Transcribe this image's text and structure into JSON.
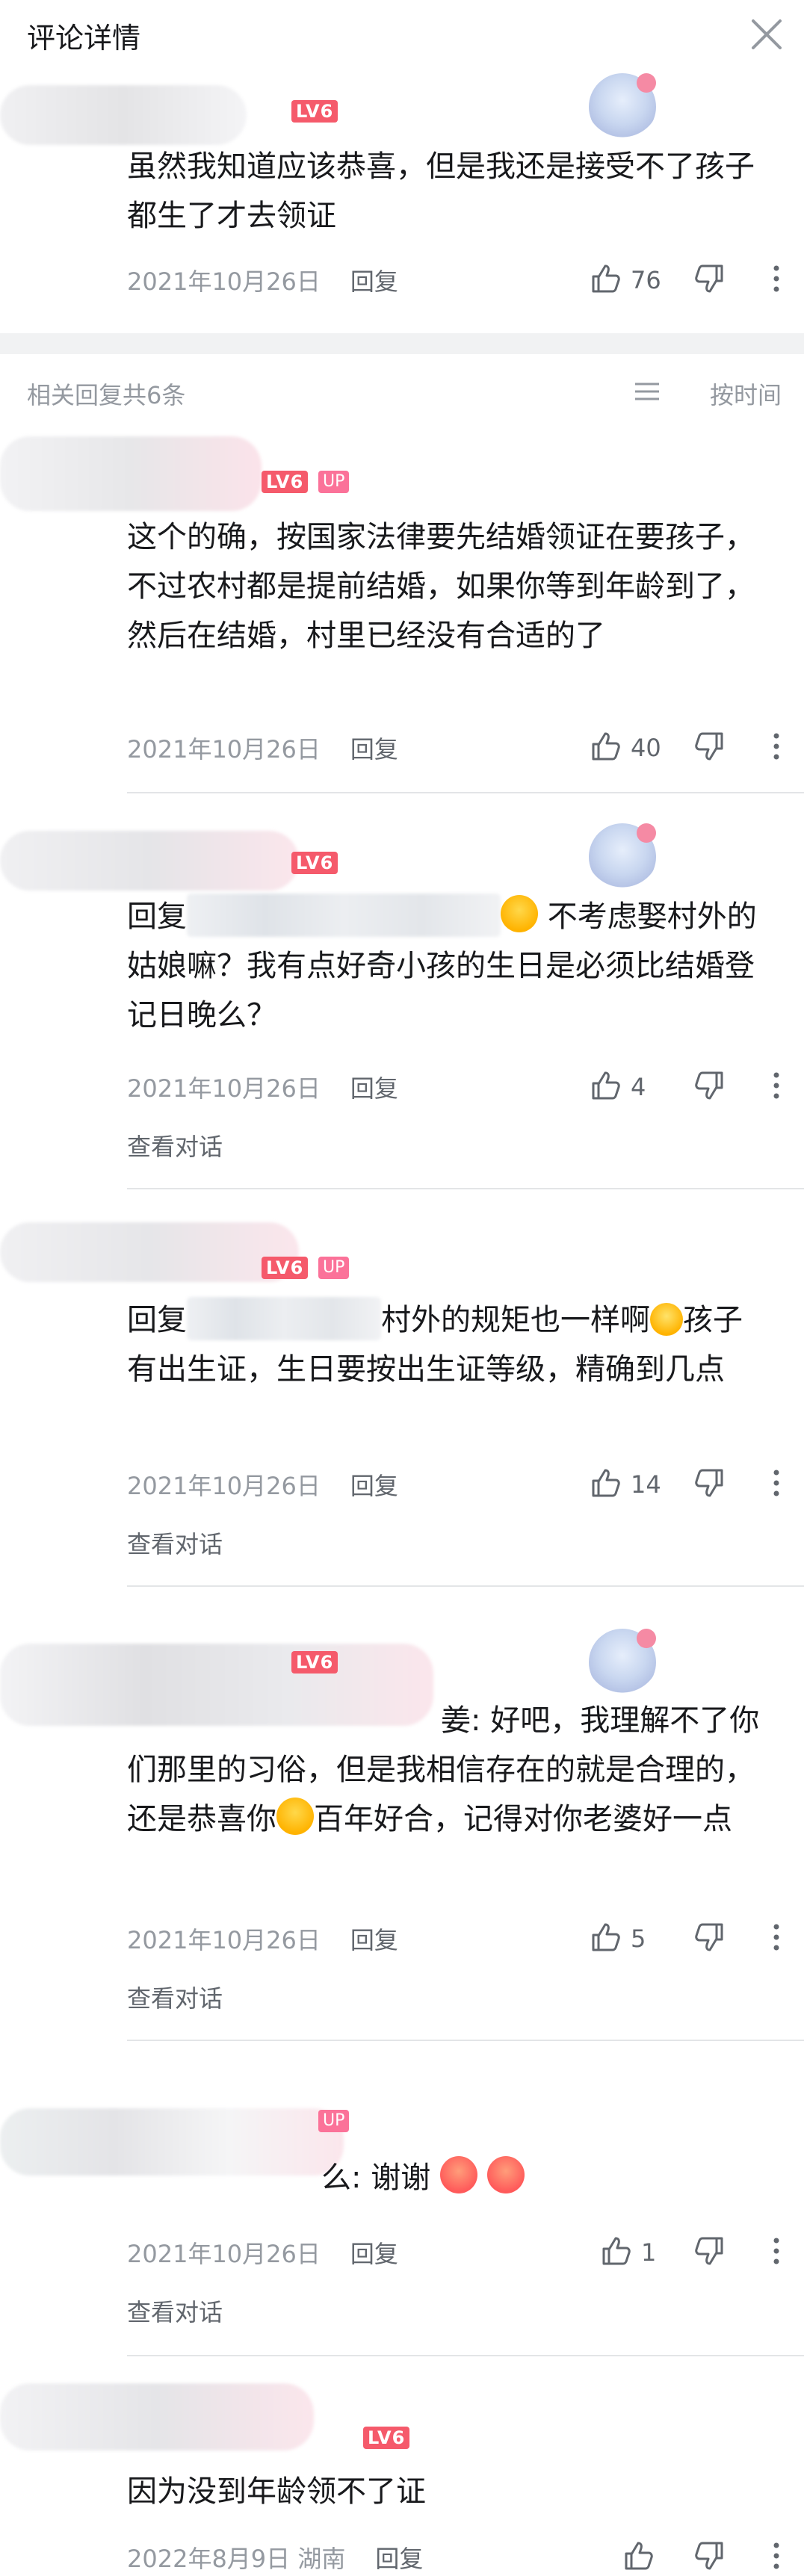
{
  "header": {
    "title": "评论详情",
    "close_icon": "close-icon"
  },
  "main_comment": {
    "level": "LV6",
    "text": "虽然我知道应该恭喜，但是我还是接受不了孩子都生了才去领证",
    "date": "2021年10月26日",
    "reply_label": "回复",
    "likes": "76"
  },
  "replies_bar": {
    "count_label": "相关回复共6条",
    "sort_label": "按时间"
  },
  "replies": [
    {
      "level": "LV6",
      "up": "UP",
      "text": "这个的确，按国家法律要先结婚领证在要孩子，不过农村都是提前结婚，如果你等到年龄到了，然后在结婚，村里已经没有合适的了",
      "date": "2021年10月26日",
      "reply_label": "回复",
      "likes": "40"
    },
    {
      "level": "LV6",
      "prefix": "回复",
      "text_after": "不考虑娶村外的姑娘嘛？我有点好奇小孩的生日是必须比结婚登记日晚么？",
      "date": "2021年10月26日",
      "reply_label": "回复",
      "likes": "4",
      "view_conversation": "查看对话"
    },
    {
      "level": "LV6",
      "up": "UP",
      "prefix": "回复",
      "text_after": "村外的规矩也一样啊",
      "text_after2": "孩子有出生证，生日要按出生证等级，精确到几点",
      "date": "2021年10月26日",
      "reply_label": "回复",
      "likes": "14",
      "view_conversation": "查看对话"
    },
    {
      "level": "LV6",
      "text_line1_end": "姜: 好吧，我理解不了",
      "text_rest1": "你们那里的习俗，但是我相信存在的就是合理的，还是恭喜你",
      "text_rest2": "百年好合，记得对你老婆好一点",
      "date": "2021年10月26日",
      "reply_label": "回复",
      "likes": "5",
      "view_conversation": "查看对话"
    },
    {
      "up": "UP",
      "text_end": "么: 谢谢",
      "date": "2021年10月26日",
      "reply_label": "回复",
      "likes": "1",
      "view_conversation": "查看对话"
    },
    {
      "level": "LV6",
      "text": "因为没到年龄领不了证",
      "date": "2022年8月9日",
      "location": "湖南",
      "reply_label": "回复"
    }
  ],
  "colors": {
    "level_badge": "#f55a6b",
    "up_badge": "#fb7299",
    "meta_gray": "#9499a0"
  }
}
